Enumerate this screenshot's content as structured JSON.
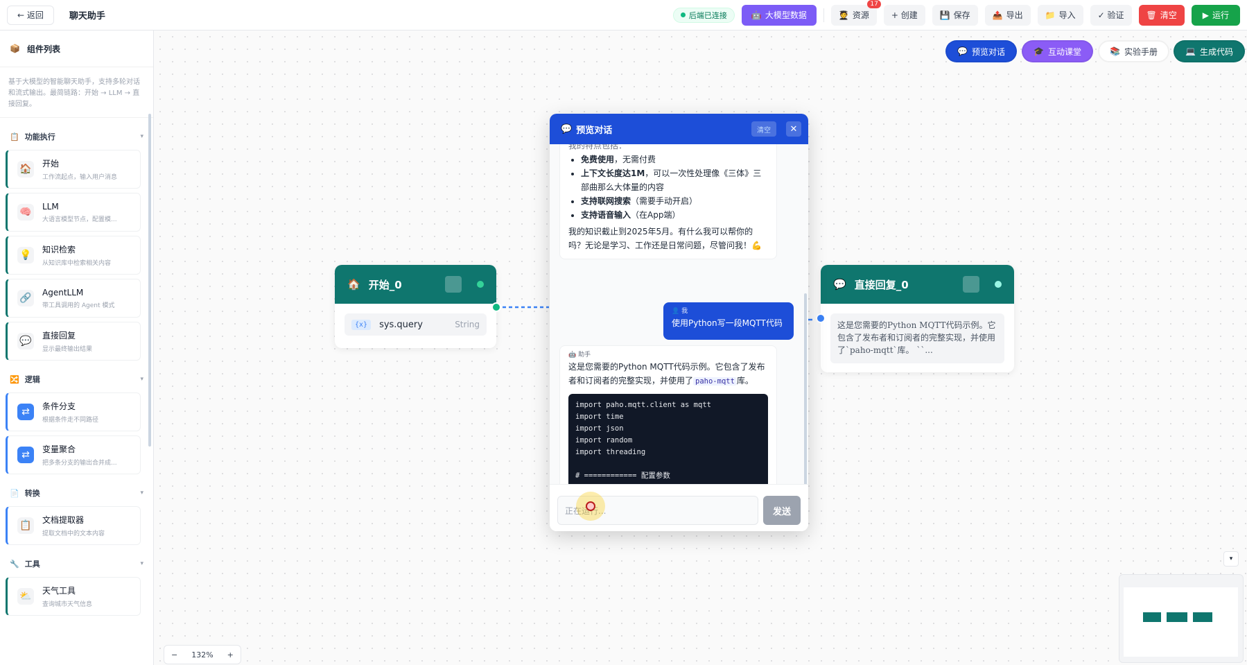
{
  "topbar": {
    "back": "← 返回",
    "title": "聊天助手",
    "connection": "后端已连接",
    "llm_data": "大模型数据",
    "resources": "资源",
    "resources_badge": "17",
    "create": "+ 创建",
    "save": "保存",
    "export": "导出",
    "import": "导入",
    "validate": "✓ 验证",
    "clear": "清空",
    "run": "运行"
  },
  "sidebar": {
    "title": "组件列表",
    "description": "基于大模型的智能聊天助手，支持多轮对话和流式输出。最简链路：开始 → LLM → 直接回复。",
    "sections": [
      {
        "title": "功能执行",
        "items": [
          {
            "name": "开始",
            "sub": "工作流起点，输入用户消息"
          },
          {
            "name": "LLM",
            "sub": "大语言模型节点，配置模..."
          },
          {
            "name": "知识检索",
            "sub": "从知识库中检索相关内容"
          },
          {
            "name": "AgentLLM",
            "sub": "带工具调用的 Agent 模式"
          },
          {
            "name": "直接回复",
            "sub": "显示最终输出结果"
          }
        ]
      },
      {
        "title": "逻辑",
        "items": [
          {
            "name": "条件分支",
            "sub": "根据条件走不同路径"
          },
          {
            "name": "变量聚合",
            "sub": "把多条分支的输出合并成..."
          }
        ]
      },
      {
        "title": "转换",
        "items": [
          {
            "name": "文档提取器",
            "sub": "提取文档中的文本内容"
          }
        ]
      },
      {
        "title": "工具",
        "items": [
          {
            "name": "天气工具",
            "sub": "查询城市天气信息"
          }
        ]
      }
    ]
  },
  "canvas_actions": {
    "preview": "预览对话",
    "classroom": "互动课堂",
    "lab_manual": "实验手册",
    "gen_code": "生成代码"
  },
  "nodes": {
    "start": {
      "title": "开始_0",
      "var": "sys.query",
      "var_icon": "{x}",
      "type": "String"
    },
    "reply": {
      "title": "直接回复_0",
      "preview": "这是您需要的Python MQTT代码示例。它包含了发布者和订阅者的完整实现，并使用了`paho-mqtt`库。 ``..."
    }
  },
  "dialog": {
    "title": "预览对话",
    "clear": "清空",
    "bot_msg1": {
      "partial_top": "我的特点包括：",
      "bullets": [
        {
          "bold": "免费使用",
          "rest": "，无需付费"
        },
        {
          "bold": "上下文长度达1M",
          "rest": "，可以一次性处理像《三体》三部曲那么大体量的内容"
        },
        {
          "bold": "支持联网搜索",
          "rest": "（需要手动开启）"
        },
        {
          "bold": "支持语音输入",
          "rest": "（在App端）"
        }
      ],
      "closing": "我的知识截止到2025年5月。有什么我可以帮你的吗？无论是学习、工作还是日常问题，尽管问我！💪"
    },
    "user_msg": {
      "label": "我",
      "text": "使用Python写一段MQTT代码"
    },
    "bot_msg2": {
      "label": "助手",
      "text_a": "这是您需要的Python MQTT代码示例。它包含了发布者和订阅者的完整实现，并使用了",
      "code_inline": "paho-mqtt",
      "text_b": "库。",
      "code": "import paho.mqtt.client as mqtt\nimport time\nimport json\nimport random\nimport threading\n\n# ============ 配置参数"
    },
    "input_placeholder": "正在运行...",
    "send": "发送"
  },
  "zoom": {
    "minus": "−",
    "level": "132%",
    "plus": "+"
  }
}
